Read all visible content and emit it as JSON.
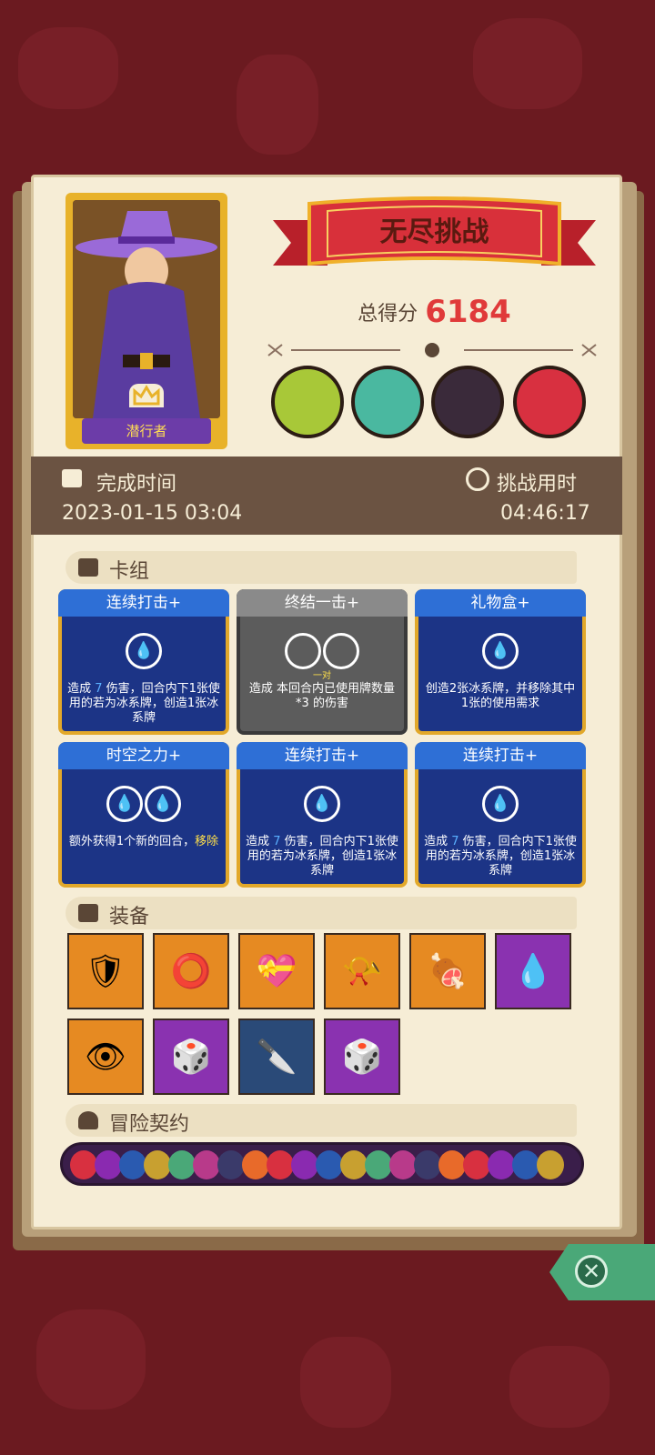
{
  "hero": {
    "name": "潜行者"
  },
  "mode": {
    "title": "无尽挑战"
  },
  "score": {
    "label": "总得分",
    "value": "6184"
  },
  "bosses": [
    {
      "icon": "skeleton-dragon-icon"
    },
    {
      "icon": "goblin-icon"
    },
    {
      "icon": "dark-robot-icon"
    },
    {
      "icon": "vampire-icon"
    }
  ],
  "stats": {
    "completion_label": "完成时间",
    "completion_value": "2023-01-15 03:04",
    "duration_label": "挑战用时",
    "duration_value": "04:46:17"
  },
  "deck": {
    "title": "卡组",
    "cards": [
      {
        "name": "连续打击+",
        "style": "blue",
        "orbs": 1,
        "orb_label": "",
        "desc_a": "造成 ",
        "desc_num": "7",
        "desc_b": " 伤害，回合内下1张使用的若为冰系牌，创造1张冰系牌",
        "desc_hl": ""
      },
      {
        "name": "终结一击+",
        "style": "gray",
        "orbs": 2,
        "orb_label": "一对",
        "desc_a": "造成 本回合内已使用牌数量*3 的伤害",
        "desc_num": "",
        "desc_b": "",
        "desc_hl": ""
      },
      {
        "name": "礼物盒+",
        "style": "blue",
        "orbs": 1,
        "orb_label": "",
        "desc_a": "创造2张冰系牌，并移除其中1张的使用需求",
        "desc_num": "",
        "desc_b": "",
        "desc_hl": ""
      },
      {
        "name": "时空之力+",
        "style": "blue",
        "orbs": 2,
        "orb_label": "",
        "desc_a": "额外获得1个新的回合，",
        "desc_num": "",
        "desc_b": "",
        "desc_hl": "移除"
      },
      {
        "name": "连续打击+",
        "style": "blue",
        "orbs": 1,
        "orb_label": "",
        "desc_a": "造成 ",
        "desc_num": "7",
        "desc_b": " 伤害，回合内下1张使用的若为冰系牌，创造1张冰系牌",
        "desc_hl": ""
      },
      {
        "name": "连续打击+",
        "style": "blue",
        "orbs": 1,
        "orb_label": "",
        "desc_a": "造成 ",
        "desc_num": "7",
        "desc_b": " 伤害，回合内下1张使用的若为冰系牌，创造1张冰系牌",
        "desc_hl": ""
      }
    ]
  },
  "equipment": {
    "title": "装备",
    "items": [
      {
        "icon": "ice-shield-icon",
        "bg": "orange",
        "glyph": "🛡"
      },
      {
        "icon": "spiked-collar-icon",
        "bg": "orange",
        "glyph": "⭕"
      },
      {
        "icon": "heart-box-icon",
        "bg": "orange",
        "glyph": "💝"
      },
      {
        "icon": "horn-icon",
        "bg": "orange",
        "glyph": "📯"
      },
      {
        "icon": "meat-icon",
        "bg": "orange",
        "glyph": "🍖"
      },
      {
        "icon": "water-drop-icon",
        "bg": "purple",
        "glyph": "💧"
      },
      {
        "icon": "eye-ring-icon",
        "bg": "orange",
        "glyph": "👁"
      },
      {
        "icon": "golden-eye-dice-icon",
        "bg": "purple",
        "glyph": "🎲"
      },
      {
        "icon": "scythe-icon",
        "bg": "navy",
        "glyph": "🔪"
      },
      {
        "icon": "spiked-dice-icon",
        "bg": "purple",
        "glyph": "🎲"
      }
    ]
  },
  "contracts": {
    "title": "冒险契约"
  },
  "colors": {
    "accent_red": "#e03a3a",
    "panel_brown": "#6b5342",
    "card_blue": "#1c3486",
    "gold": "#e2a82a"
  }
}
